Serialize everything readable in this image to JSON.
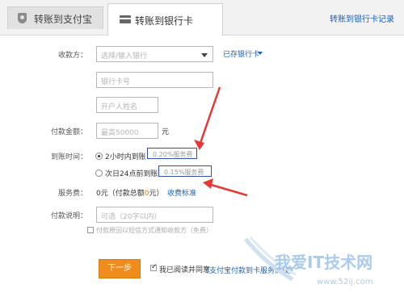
{
  "tabs": [
    {
      "label": "转账到支付宝",
      "icon": "shield-icon"
    },
    {
      "label": "转账到银行卡",
      "icon": "bank-card-icon"
    }
  ],
  "header": {
    "record_link": "转账到银行卡记录"
  },
  "form": {
    "payee_label": "收款方：",
    "bank_select_placeholder": "选择/输入银行",
    "saved_cards_link": "已存银行卡",
    "card_number_placeholder": "银行卡号",
    "account_name_placeholder": "开户人姓名",
    "amount_label": "付款金额：",
    "amount_placeholder": "最高50000",
    "amount_unit": "元",
    "arrival_label": "到账时间：",
    "arrival_options": [
      {
        "label": "2小时内到账",
        "fee": "0.20%服务费",
        "selected": true
      },
      {
        "label": "次日24点前到账",
        "fee": "0.15%服务费",
        "selected": false
      }
    ],
    "service_fee_label": "服务费：",
    "service_fee_value": "0元（付款总额",
    "service_fee_zero": "0",
    "service_fee_suffix": "元）",
    "fee_standard_link": "收费标准",
    "memo_label": "付款说明：",
    "memo_placeholder": "可选（20字以内）",
    "sms_notify_label": "付款原因以短信方式通知收款方（免费）",
    "next_button": "下一步",
    "agree_text": "我已阅读并同意",
    "agree_link": "《支付宝付款到卡服务协议》"
  },
  "watermark": {
    "text": "我爱IT技术网",
    "url": "www.52ij.com"
  },
  "colors": {
    "accent_orange": "#f08c1e",
    "link_blue": "#1f61b5",
    "annotation_red": "#e53935",
    "box_blue": "#2f4db5"
  }
}
